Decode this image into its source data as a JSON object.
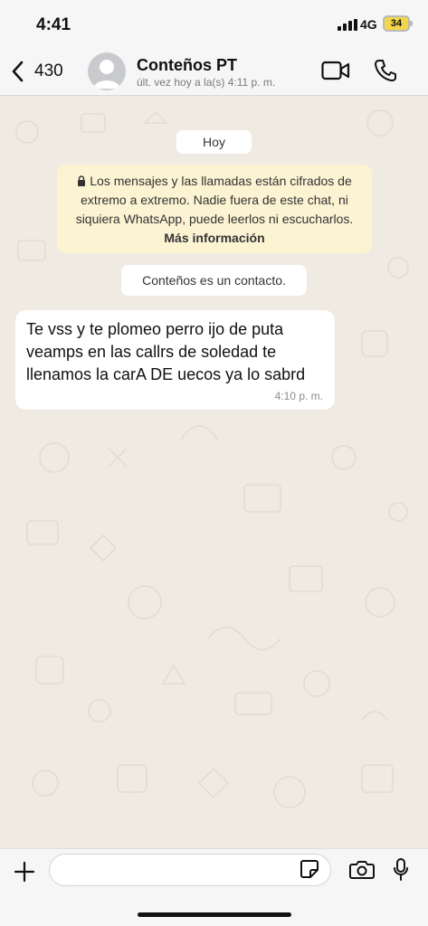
{
  "status_bar": {
    "time": "4:41",
    "network": "4G",
    "battery": "34"
  },
  "header": {
    "back_count": "430",
    "contact_name": "Conteños PT",
    "last_seen": "últ. vez hoy a la(s) 4:11 p. m."
  },
  "chat": {
    "day_label": "Hoy",
    "encryption_notice": "Los mensajes y las llamadas están cifrados de extremo a extremo. Nadie fuera de este chat, ni siquiera WhatsApp, puede leerlos ni escucharlos.",
    "encryption_link": "Más información",
    "contact_notice": "Conteños es un contacto.",
    "messages": [
      {
        "text": "Te vss  y te  plomeo  perro ijo de puta veamps en las callrs de soledad te llenamos la carA DE uecos ya lo sabrd",
        "time": "4:10 p. m."
      }
    ]
  },
  "input_bar": {
    "placeholder": ""
  },
  "colors": {
    "chat_background": "#efeae2",
    "encryption_bg": "#fcf3d3",
    "bubble_bg": "#ffffff",
    "battery_fill": "#f2d64a"
  },
  "icons": [
    "back-chevron-icon",
    "avatar-icon",
    "video-call-icon",
    "phone-icon",
    "lock-icon",
    "plus-icon",
    "sticker-icon",
    "camera-icon",
    "microphone-icon"
  ]
}
